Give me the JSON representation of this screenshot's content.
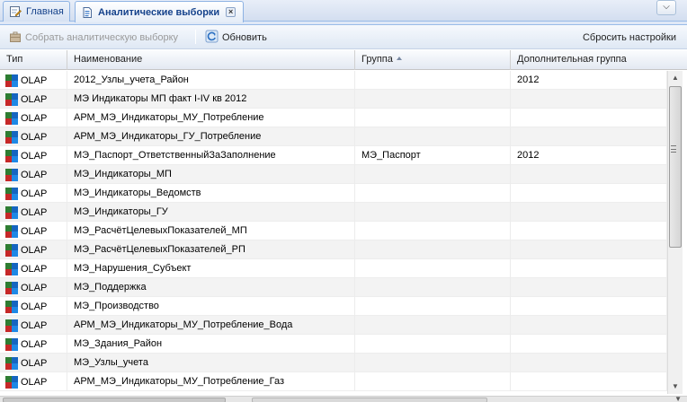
{
  "tabs": [
    {
      "label": "Главная",
      "icon": "edit-page-icon",
      "active": false
    },
    {
      "label": "Аналитические выборки",
      "icon": "document-icon",
      "active": true
    }
  ],
  "toolbar": {
    "build_label": "Собрать аналитическую выборку",
    "refresh_label": "Обновить",
    "reset_label": "Сбросить настройки"
  },
  "grid": {
    "columns": {
      "type": "Тип",
      "name": "Наименование",
      "group": "Группа",
      "extra_group": "Дополнительная группа"
    },
    "sorted_column": "group",
    "sort_direction": "asc",
    "rows": [
      {
        "type": "OLAP",
        "name": "2012_Узлы_учета_Район",
        "group": "",
        "extra": "2012"
      },
      {
        "type": "OLAP",
        "name": "МЭ Индикаторы МП факт I-IV кв 2012",
        "group": "",
        "extra": ""
      },
      {
        "type": "OLAP",
        "name": "АРМ_МЭ_Индикаторы_МУ_Потребление",
        "group": "",
        "extra": ""
      },
      {
        "type": "OLAP",
        "name": "АРМ_МЭ_Индикаторы_ГУ_Потребление",
        "group": "",
        "extra": ""
      },
      {
        "type": "OLAP",
        "name": "МЭ_Паспорт_ОтветственныйЗаЗаполнение",
        "group": "МЭ_Паспорт",
        "extra": "2012"
      },
      {
        "type": "OLAP",
        "name": "МЭ_Индикаторы_МП",
        "group": "",
        "extra": ""
      },
      {
        "type": "OLAP",
        "name": "МЭ_Индикаторы_Ведомств",
        "group": "",
        "extra": ""
      },
      {
        "type": "OLAP",
        "name": "МЭ_Индикаторы_ГУ",
        "group": "",
        "extra": ""
      },
      {
        "type": "OLAP",
        "name": "МЭ_РасчётЦелевыхПоказателей_МП",
        "group": "",
        "extra": ""
      },
      {
        "type": "OLAP",
        "name": "МЭ_РасчётЦелевыхПоказателей_РП",
        "group": "",
        "extra": ""
      },
      {
        "type": "OLAP",
        "name": "МЭ_Нарушения_Субъект",
        "group": "",
        "extra": ""
      },
      {
        "type": "OLAP",
        "name": "МЭ_Поддержка",
        "group": "",
        "extra": ""
      },
      {
        "type": "OLAP",
        "name": "МЭ_Производство",
        "group": "",
        "extra": ""
      },
      {
        "type": "OLAP",
        "name": "АРМ_МЭ_Индикаторы_МУ_Потребление_Вода",
        "group": "",
        "extra": ""
      },
      {
        "type": "OLAP",
        "name": "МЭ_Здания_Район",
        "group": "",
        "extra": ""
      },
      {
        "type": "OLAP",
        "name": "МЭ_Узлы_учета",
        "group": "",
        "extra": ""
      },
      {
        "type": "OLAP",
        "name": "АРМ_МЭ_Индикаторы_МУ_Потребление_Газ",
        "group": "",
        "extra": ""
      }
    ]
  }
}
